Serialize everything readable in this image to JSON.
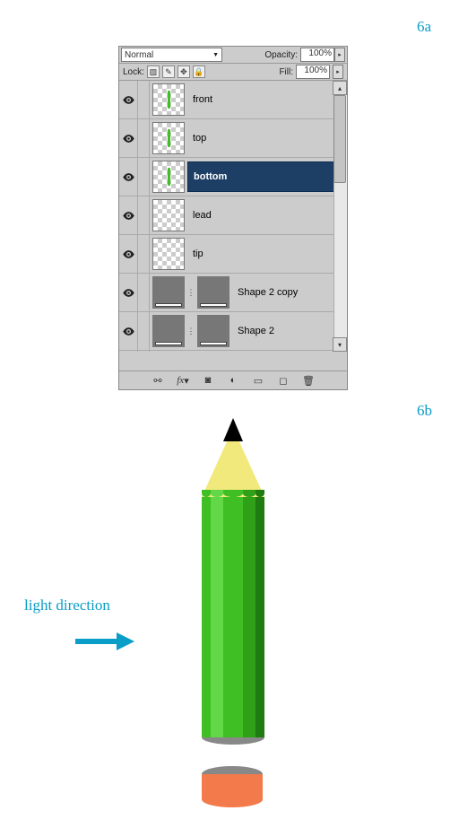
{
  "steps": {
    "a": "6a",
    "b": "6b"
  },
  "panel": {
    "blend_mode": "Normal",
    "opacity_label": "Opacity:",
    "opacity_value": "100%",
    "lock_label": "Lock:",
    "fill_label": "Fill:",
    "fill_value": "100%"
  },
  "layers": [
    {
      "name": "front",
      "visible": true,
      "thumb": "line",
      "selected": false,
      "kind": "normal"
    },
    {
      "name": "top",
      "visible": true,
      "thumb": "line",
      "selected": false,
      "kind": "normal"
    },
    {
      "name": "bottom",
      "visible": true,
      "thumb": "line",
      "selected": true,
      "kind": "normal"
    },
    {
      "name": "lead",
      "visible": true,
      "thumb": "checker",
      "selected": false,
      "kind": "normal"
    },
    {
      "name": "tip",
      "visible": true,
      "thumb": "checker",
      "selected": false,
      "kind": "normal"
    },
    {
      "name": "Shape 2 copy",
      "visible": true,
      "thumb": "grey",
      "selected": false,
      "kind": "vector"
    },
    {
      "name": "Shape 2",
      "visible": true,
      "thumb": "grey",
      "selected": false,
      "kind": "vector"
    }
  ],
  "footer_icons": [
    "link",
    "fx",
    "mask",
    "adjust",
    "group",
    "new",
    "trash"
  ],
  "annotation": "light direction"
}
